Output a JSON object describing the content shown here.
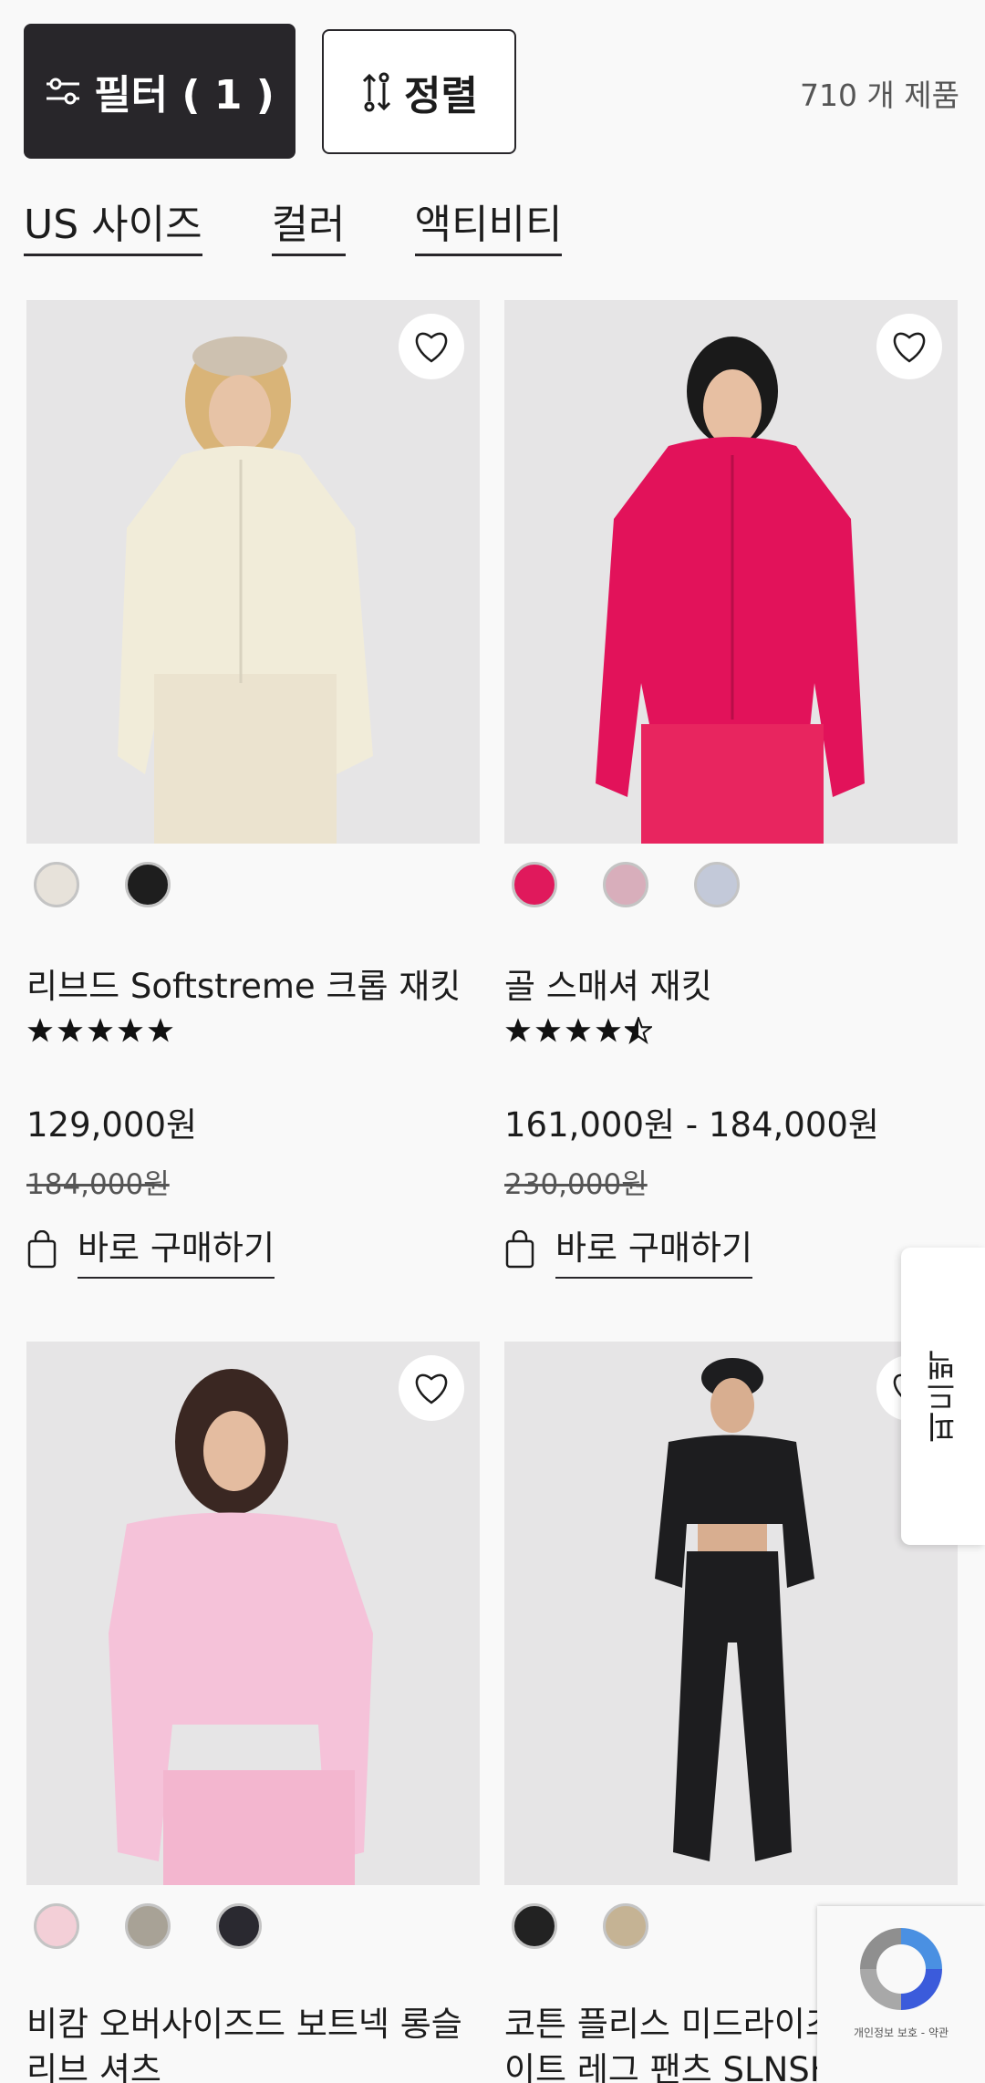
{
  "toolbar": {
    "filter_label": "필터 ( 1 )",
    "sort_label": "정렬",
    "product_count": "710 개 제품"
  },
  "chips": [
    "US 사이즈",
    "컬러",
    "액티비티"
  ],
  "products": [
    {
      "name": "리브드 Softstreme 크롭 재킷",
      "rating": 5,
      "price": "129,000원",
      "was_price": "184,000원",
      "buy_label": "바로 구매하기",
      "swatches": [
        "#e7e2da",
        "#1e1e1e"
      ],
      "image_bg": "#e6e5e6",
      "garment_color": "#f1ecd9"
    },
    {
      "name": "골 스매셔 재킷",
      "rating": 4.5,
      "price": "161,000원 - 184,000원",
      "was_price": "230,000원",
      "buy_label": "바로 구매하기",
      "swatches": [
        "#e0195c",
        "#d8aebb",
        "#c3c9d9"
      ],
      "image_bg": "#e6e5e6",
      "garment_color": "#e2125a"
    },
    {
      "name": "비캄 오버사이즈드 보트넥 롱슬리브 셔츠",
      "name_line1": "비캄 오버사이즈드 보트넥 롱슬",
      "name_line2": "리브 셔츠",
      "swatches": [
        "#f3cfd7",
        "#a8a296",
        "#2a2930"
      ],
      "image_bg": "#e6e5e6",
      "garment_color": "#f5c2d9"
    },
    {
      "name_line1": "코튼 플리스 미드라이즈 스트레",
      "name_line2": "이트 레그 팬츠 SLNSH 컬렉션",
      "swatches": [
        "#222222",
        "#c5b394"
      ],
      "image_bg": "#e6e5e6",
      "garment_color": "#1d1d1f"
    }
  ],
  "side_tab_label": "피드백",
  "recaptcha": {
    "text": "개인정보 보호 - 약관"
  },
  "icons": {
    "filter": "sliders-icon",
    "sort": "sort-arrows-icon",
    "favorite": "heart-icon",
    "bag": "shopping-bag-icon",
    "star": "star-icon"
  },
  "colors": {
    "dark": "#28262a",
    "background": "#f9f9f9"
  }
}
